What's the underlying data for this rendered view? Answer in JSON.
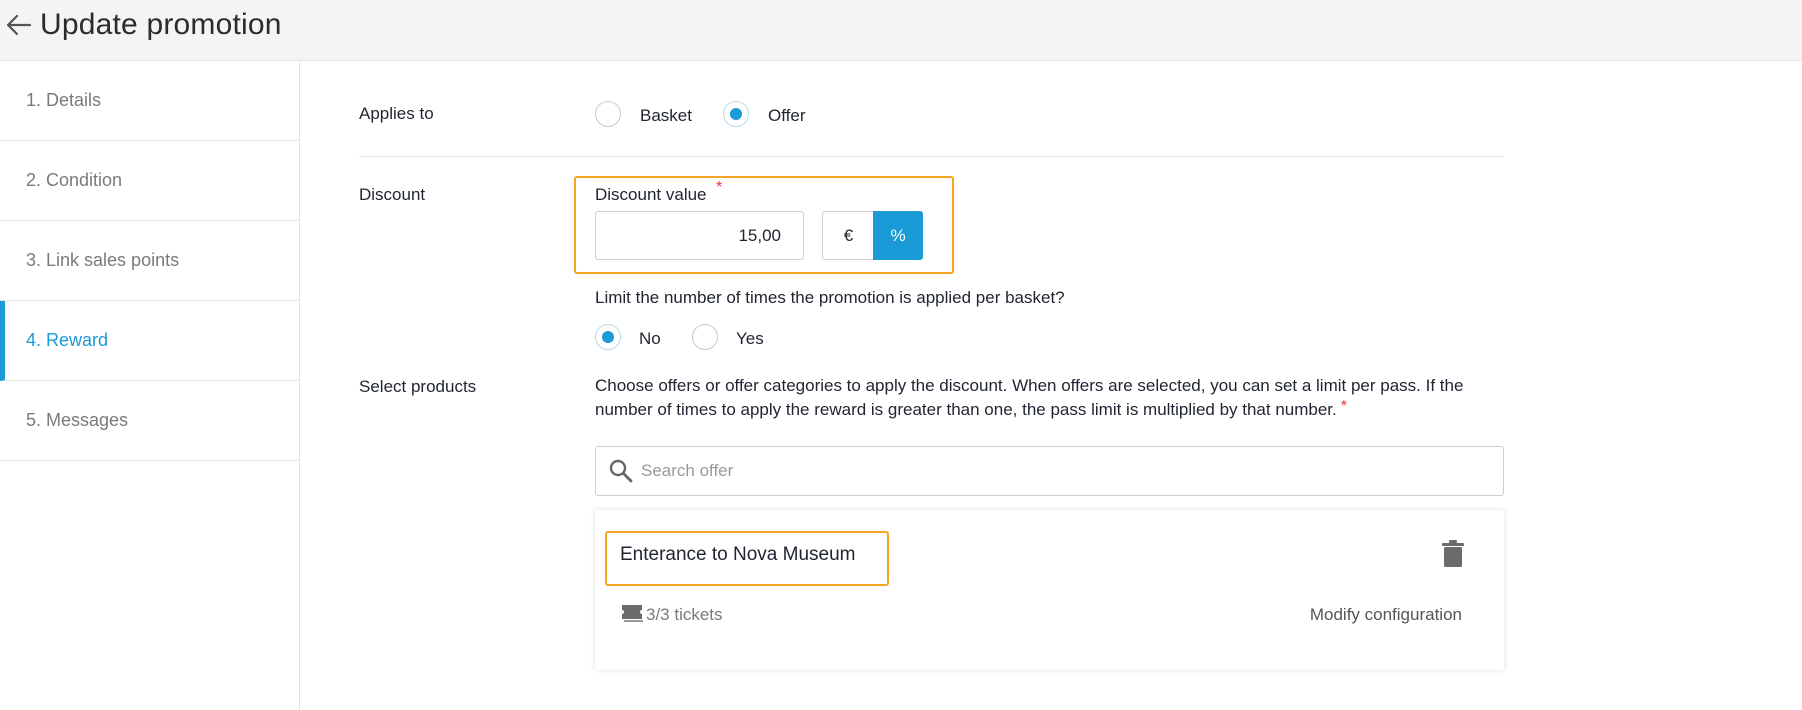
{
  "header": {
    "title": "Update promotion"
  },
  "steps": [
    {
      "label": "1. Details"
    },
    {
      "label": "2. Condition"
    },
    {
      "label": "3. Link sales points"
    },
    {
      "label": "4. Reward"
    },
    {
      "label": "5. Messages"
    }
  ],
  "applies_to": {
    "label": "Applies to",
    "options": [
      "Basket",
      "Offer"
    ],
    "selected": "Offer"
  },
  "discount": {
    "section_label": "Discount",
    "field_label": "Discount value",
    "required_mark": "*",
    "value": "15,00",
    "units": [
      "€",
      "%"
    ],
    "selected_unit": "%"
  },
  "limit": {
    "question": "Limit the number of times the promotion is applied per basket?",
    "options": [
      "No",
      "Yes"
    ],
    "selected": "No"
  },
  "products": {
    "section_label": "Select products",
    "description": "Choose offers or offer categories to apply the discount. When offers are selected, you can set a limit per pass. If the number of times to apply the reward is greater than one, the pass limit is multiplied by that number.",
    "required_mark": "*",
    "search_placeholder": "Search offer",
    "offer": {
      "title": "Enterance to Nova Museum",
      "tickets": "3/3 tickets",
      "modify_label": "Modify configuration"
    }
  },
  "colors": {
    "accent": "#1a9ad6",
    "highlight": "#f5a623",
    "required": "#e53935"
  }
}
